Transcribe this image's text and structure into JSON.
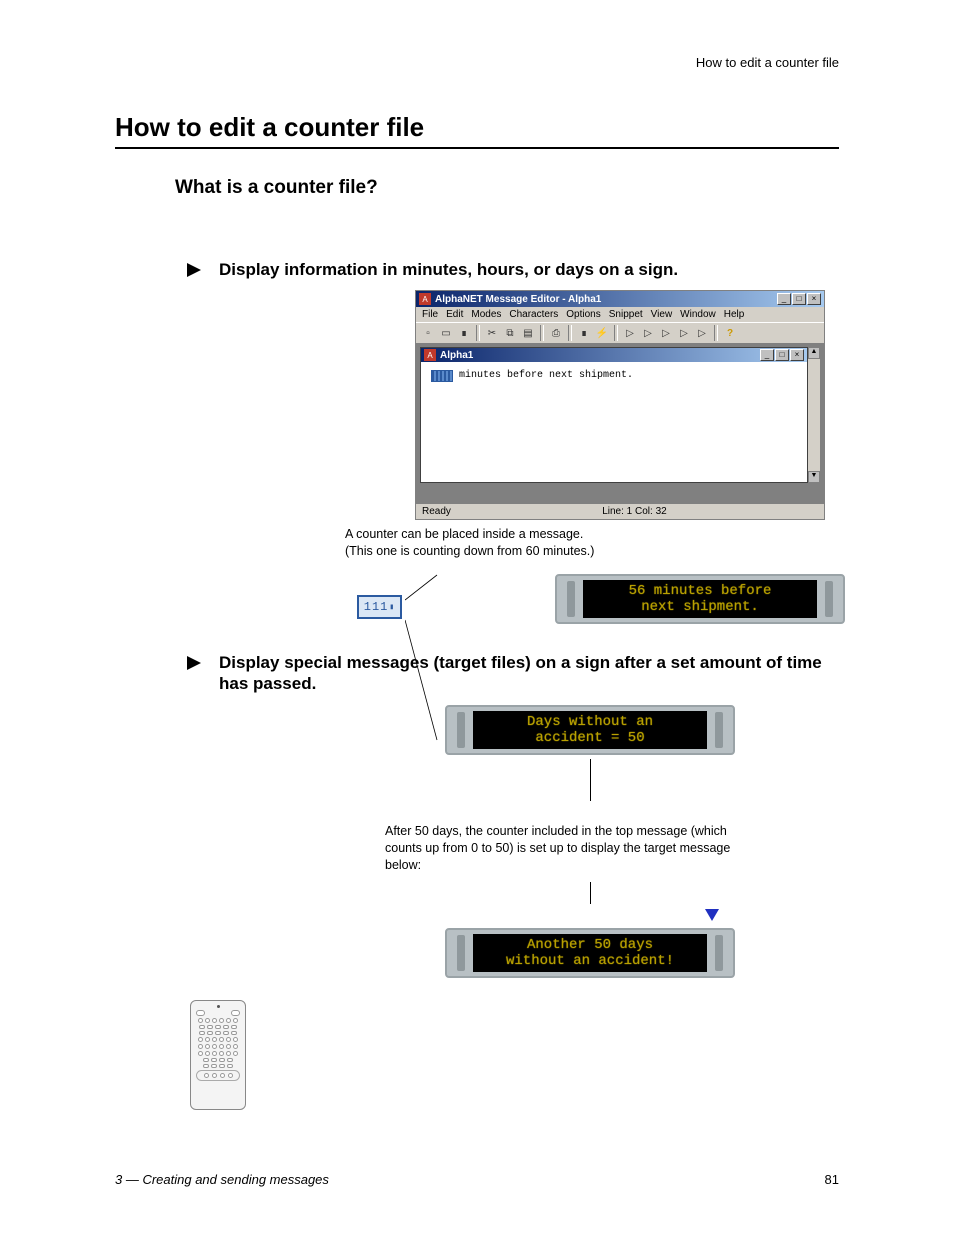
{
  "running_head": "How to edit a counter file",
  "h1": "How to edit a counter file",
  "h2": "What is a counter file?",
  "bullet1": "Display information in minutes, hours, or days on a sign.",
  "bullet2": "Display special messages (target files) on a sign after a set amount of time has passed.",
  "editor": {
    "title": "AlphaNET Message Editor - Alpha1",
    "menus": [
      "File",
      "Edit",
      "Modes",
      "Characters",
      "Options",
      "Snippet",
      "View",
      "Window",
      "Help"
    ],
    "child_title": "Alpha1",
    "body_text": "minutes before next shipment.",
    "status_left": "Ready",
    "status_right": "Line: 1   Col: 32"
  },
  "counter_chip_label": "111",
  "caption1_line1": "A counter can be placed inside a message.",
  "caption1_line2": "(This one is counting down from 60 minutes.)",
  "sign1": "56 minutes before\nnext shipment.",
  "sign2": "Days without an\naccident = 50",
  "mid_caption": "After 50 days, the counter included in the top message (which counts up from 0 to 50) is set up to display the target message below:",
  "sign3": "Another 50 days\nwithout an accident!",
  "footer_section": "3 — Creating and sending messages",
  "footer_page": "81"
}
